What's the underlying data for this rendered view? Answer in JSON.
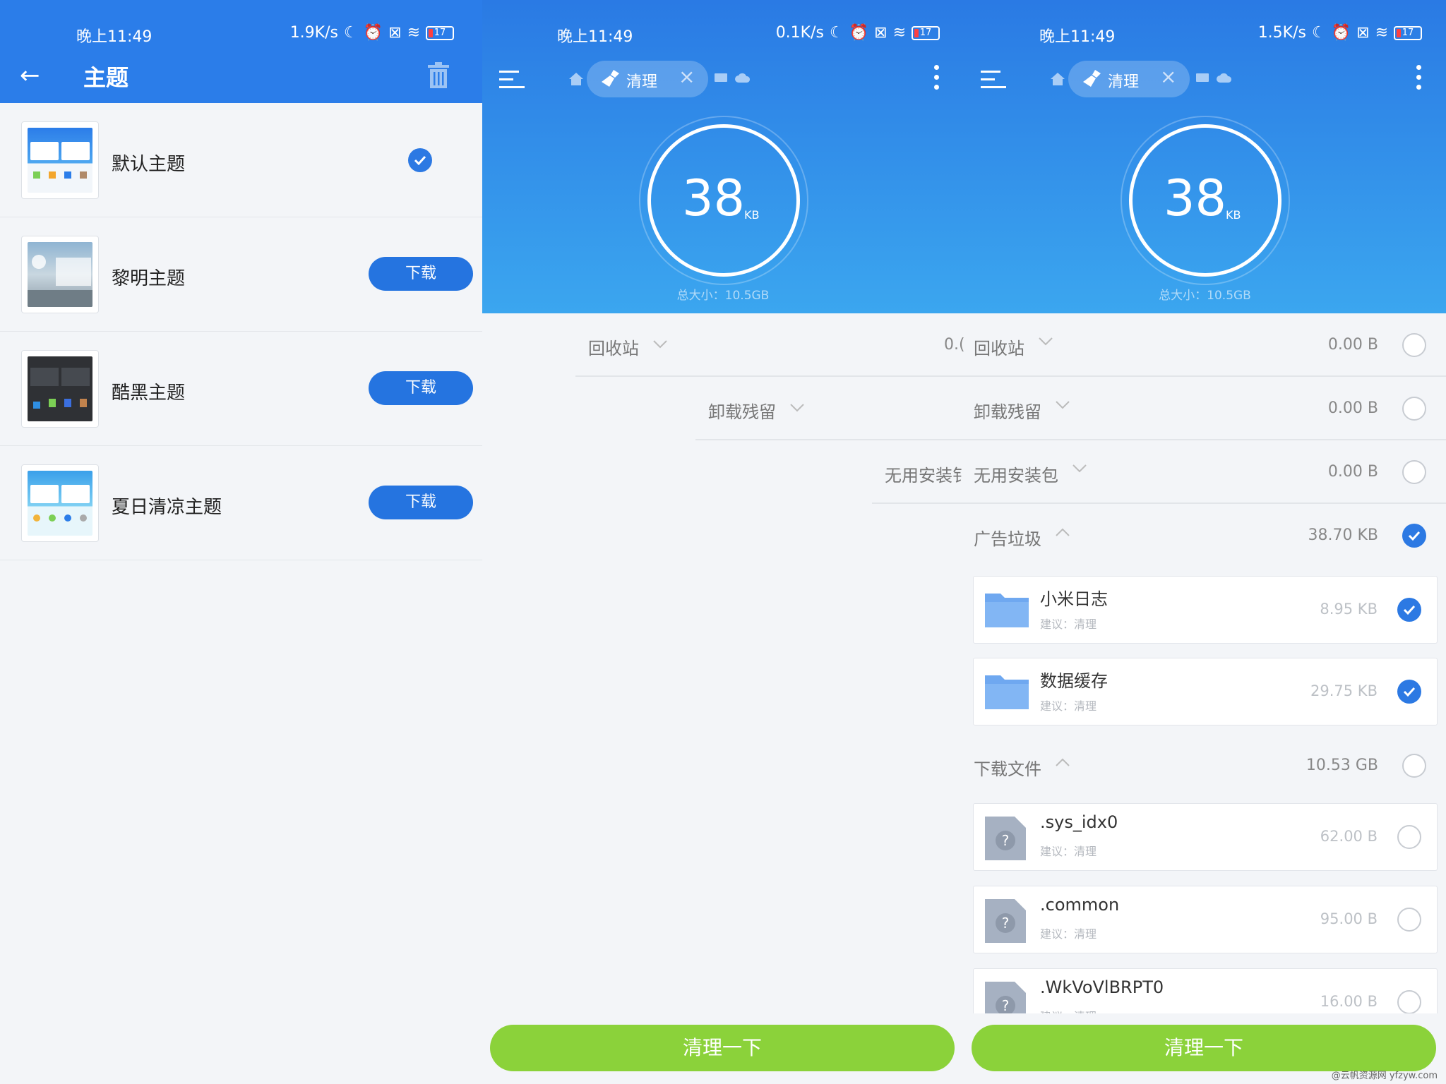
{
  "status_bar": {
    "p1": {
      "time": "晚上11:49",
      "speed": "1.9K/s",
      "battery": "17"
    },
    "p2": {
      "time": "晚上11:49",
      "speed": "0.1K/s",
      "battery": "17"
    },
    "p3": {
      "time": "晚上11:49",
      "speed": "1.5K/s",
      "battery": "17"
    }
  },
  "theme_page": {
    "title": "主题",
    "themes": [
      {
        "name": "默认主题",
        "selected": true
      },
      {
        "name": "黎明主题",
        "button": "下载"
      },
      {
        "name": "酷黑主题",
        "button": "下载"
      },
      {
        "name": "夏日清凉主题",
        "button": "下载"
      }
    ]
  },
  "clean_page": {
    "tab_label": "清理",
    "size_number": "38",
    "size_unit": "KB",
    "total": "总大小：10.5GB",
    "clean_button": "清理一下",
    "p2_rows": {
      "recycle": "回收站",
      "recycle_size": "0.(",
      "uninstall": "卸载残留",
      "apk": "无用安装钅"
    },
    "categories": [
      {
        "name": "回收站",
        "size": "0.00 B",
        "checked": false,
        "expanded": false
      },
      {
        "name": "卸载残留",
        "size": "0.00 B",
        "checked": false,
        "expanded": false
      },
      {
        "name": "无用安装包",
        "size": "0.00 B",
        "checked": false,
        "expanded": false
      },
      {
        "name": "广告垃圾",
        "size": "38.70 KB",
        "checked": true,
        "expanded": true
      },
      {
        "name": "下载文件",
        "size": "10.53 GB",
        "checked": false,
        "expanded": true
      }
    ],
    "ad_items": [
      {
        "name": "小米日志",
        "sub": "建议：清理",
        "size": "8.95 KB",
        "checked": true
      },
      {
        "name": "数据缓存",
        "sub": "建议：清理",
        "size": "29.75 KB",
        "checked": true
      }
    ],
    "download_items": [
      {
        "name": ".sys_idx0",
        "sub": "建议：清理",
        "size": "62.00 B",
        "checked": false
      },
      {
        "name": ".common",
        "sub": "建议：清理",
        "size": "95.00 B",
        "checked": false
      },
      {
        "name": ".WkVoVlBRPT0",
        "sub": "建议：清理",
        "size": "16.00 B",
        "checked": false
      }
    ],
    "watermark": "@云帆资源网 yfzyw.com"
  },
  "colors": {
    "primary_blue": "#2b7de9",
    "button_blue": "#2574e0",
    "clean_green": "#8bd23a",
    "check_blue": "#2c79e3"
  }
}
